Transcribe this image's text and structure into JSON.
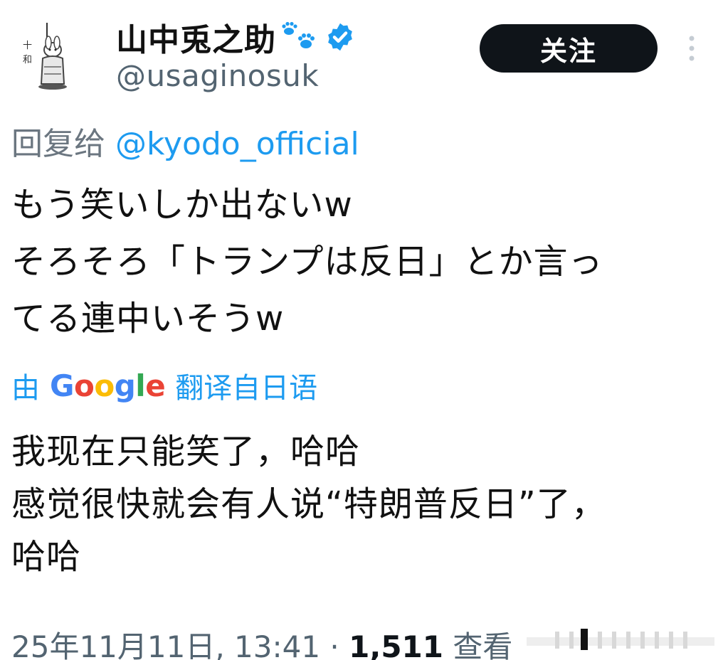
{
  "user": {
    "display_name": "山中兎之助",
    "handle": "@usaginosuk",
    "verified": true,
    "paw_icon": "paw-prints-icon",
    "verified_icon": "verified-badge-icon"
  },
  "actions": {
    "follow_label": "关注",
    "more_icon": "vertical-ellipsis-icon"
  },
  "reply": {
    "prefix": "回复给",
    "target": "@kyodo_official"
  },
  "tweet": {
    "original_lines": [
      "もう笑いしか出ないw",
      "そろそろ「トランプは反日」とか言っ",
      "てる連中いそうw"
    ],
    "translation_label_prefix": "由",
    "translation_brand": "Google",
    "translation_label_suffix": "翻译自日语",
    "translated_lines": [
      "我现在只能笑了，哈哈",
      "感觉很快就会有人说“特朗普反日”了，",
      "哈哈"
    ]
  },
  "footer": {
    "timestamp": "25年11月11日, 13:41 ·",
    "views_count": "1,511",
    "views_label": "查看"
  },
  "colors": {
    "accent": "#1d9bf0",
    "follow_bg": "#0f1419",
    "secondary_text": "#536471"
  }
}
